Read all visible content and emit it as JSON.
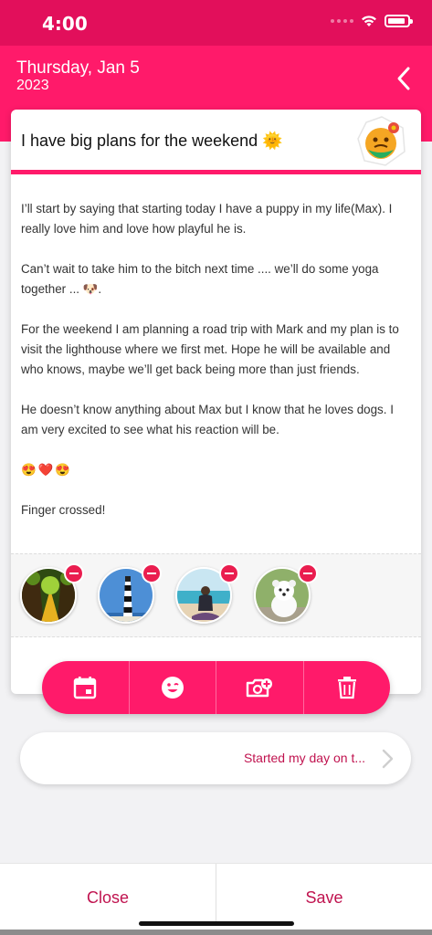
{
  "status_bar": {
    "time": "4:00"
  },
  "header": {
    "date": "Thursday, Jan 5",
    "year": "2023"
  },
  "entry": {
    "title": "I have big plans for the weekend 🌞",
    "paragraphs": [
      "I’ll start by saying that starting today I have a puppy in my life(Max).  I really love him and love how playful he is.",
      "Can’t wait to take him to the bitch next time .... we’ll do some yoga together ... 🐶.",
      "For the weekend I am planning a road trip with Mark and my plan is to visit the lighthouse where we first met. Hope he will be available and who knows, maybe we’ll get back being more than just friends.",
      "He doesn’t know anything about Max but I know that he loves dogs. I am very excited to see what his reaction will be."
    ],
    "emojis": [
      "😍",
      "❤️",
      "😍"
    ],
    "closing": "Finger crossed!"
  },
  "photos": [
    {
      "subject": "forest path"
    },
    {
      "subject": "lighthouse"
    },
    {
      "subject": "yoga on beach"
    },
    {
      "subject": "white puppy"
    }
  ],
  "actions": [
    "calendar-icon",
    "emoji-icon",
    "add-photo-icon",
    "trash-icon"
  ],
  "activity": {
    "label": "Started my day on t..."
  },
  "footer": {
    "close_label": "Close",
    "save_label": "Save"
  },
  "colors": {
    "primary": "#ff1a6a",
    "status_bar": "#e20f5b",
    "text_accent": "#c0134f"
  }
}
